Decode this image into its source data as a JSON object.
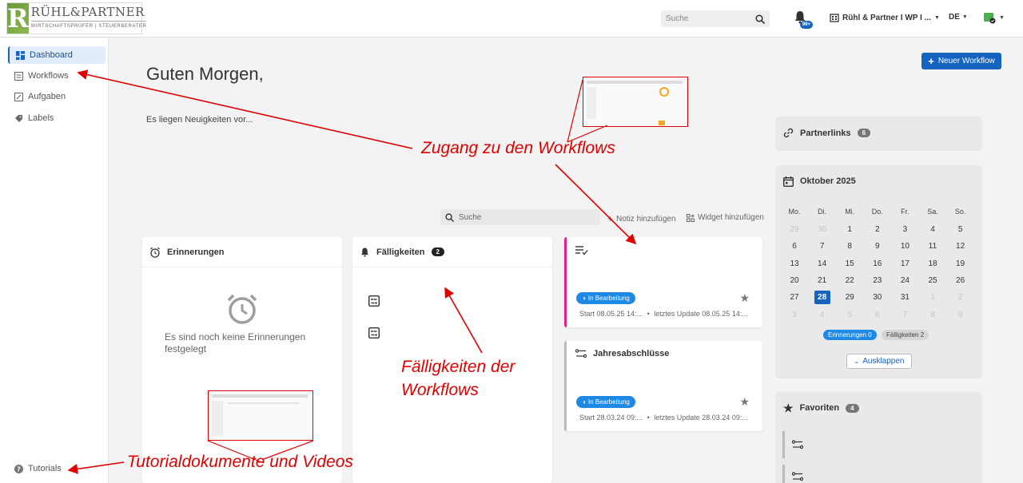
{
  "header": {
    "logo_name": "RÜHL&PARTNER",
    "logo_sub": "WIRTSCHAFTSPRÜFER | STEUERBERATER",
    "search_placeholder": "Suche",
    "notification_badge": "99+",
    "org_name": "Rühl & Partner I WP I ...",
    "language": "DE"
  },
  "sidebar": {
    "items": [
      {
        "label": "Dashboard",
        "icon": "dashboard-icon"
      },
      {
        "label": "Workflows",
        "icon": "workflow-icon"
      },
      {
        "label": "Aufgaben",
        "icon": "task-icon"
      },
      {
        "label": "Labels",
        "icon": "label-icon"
      }
    ],
    "tutorials": "Tutorials"
  },
  "main": {
    "greeting": "Guten Morgen,",
    "news": "Es liegen Neuigkeiten vor...",
    "new_workflow": "Neuer Workflow",
    "search_placeholder": "Suche",
    "add_note": "Notiz hinzufügen",
    "add_widget": "Widget hinzufügen"
  },
  "reminders": {
    "title": "Erinnerungen",
    "empty": "Es sind noch keine Erinnerungen festgelegt"
  },
  "due": {
    "title": "Fälligkeiten",
    "count": "2"
  },
  "workflows": [
    {
      "title": "",
      "status": "In Bearbeitung",
      "start": "Start 08.05.25 14:...",
      "update": "letztes Update 08.05.25 14:...",
      "accent": "#e91e8c"
    },
    {
      "title": "Jahresabschlüsse",
      "status": "In Bearbeitung",
      "start": "Start 28.03.24 09:...",
      "update": "letztes Update 28.03.24 09:...",
      "accent": "#bdbdbd"
    }
  ],
  "partnerlinks": {
    "title": "Partnerlinks",
    "count": "6"
  },
  "calendar": {
    "title": "Oktober 2025",
    "weekdays": [
      "Mo.",
      "Di.",
      "Mi.",
      "Do.",
      "Fr.",
      "Sa.",
      "So."
    ],
    "days": [
      [
        "29",
        "30",
        "1",
        "2",
        "3",
        "4",
        "5"
      ],
      [
        "6",
        "7",
        "8",
        "9",
        "10",
        "11",
        "12"
      ],
      [
        "13",
        "14",
        "15",
        "16",
        "17",
        "18",
        "19"
      ],
      [
        "20",
        "21",
        "22",
        "23",
        "24",
        "25",
        "26"
      ],
      [
        "27",
        "28",
        "29",
        "30",
        "31",
        "1",
        "2"
      ],
      [
        "3",
        "4",
        "5",
        "6",
        "7",
        "8",
        "9"
      ]
    ],
    "today": "28",
    "reminders_pill": "Erinnerungen 0",
    "due_pill": "Fälligkeiten 2",
    "expand": "Ausklappen"
  },
  "favorites": {
    "title": "Favoriten",
    "count": "4"
  },
  "annotations": {
    "workflows_access": "Zugang zu den Workflows",
    "due_line1": "Fälligkeiten der",
    "due_line2": "Workflows",
    "tutorials": "Tutorialdokumente und Videos"
  },
  "colors": {
    "primary": "#1565c0",
    "annotation": "#e00000"
  }
}
